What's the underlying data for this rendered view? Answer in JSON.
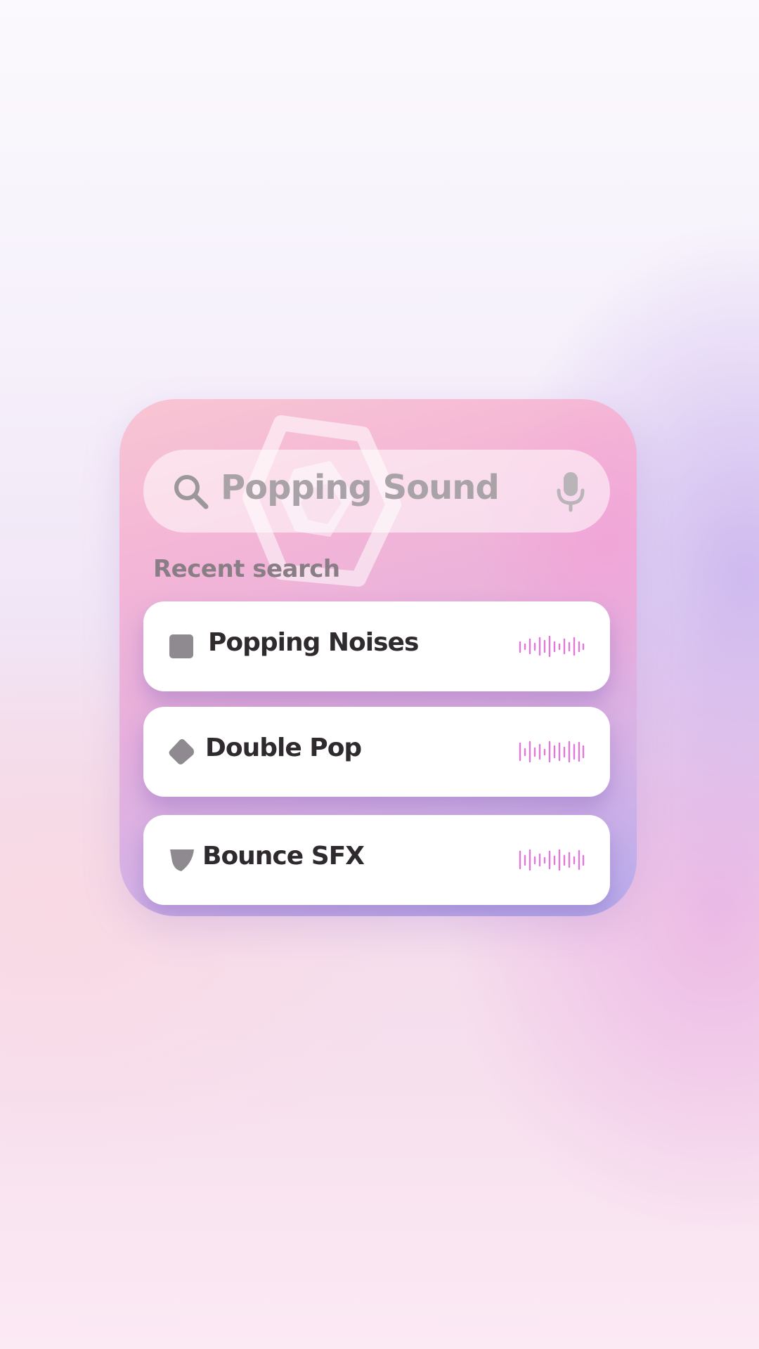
{
  "search": {
    "query": "Popping Sound",
    "search_icon": "search-icon",
    "mic_icon": "microphone-icon"
  },
  "recent": {
    "heading": "Recent search",
    "items": [
      {
        "label": "Popping Noises",
        "icon": "square-shape-icon",
        "waveform_icon": "waveform-icon"
      },
      {
        "label": "Double Pop",
        "icon": "diamond-shape-icon",
        "waveform_icon": "waveform-icon"
      },
      {
        "label": "Bounce SFX",
        "icon": "shield-shape-icon",
        "waveform_icon": "waveform-icon"
      }
    ]
  },
  "colors": {
    "card_gradient_top": "#f8c6d3",
    "card_gradient_bottom": "#b6acec",
    "waveform": "#e07ad8",
    "item_icon": "#8f8a8f",
    "item_text": "#2f2a2e",
    "search_text": "#a9a3a8"
  }
}
